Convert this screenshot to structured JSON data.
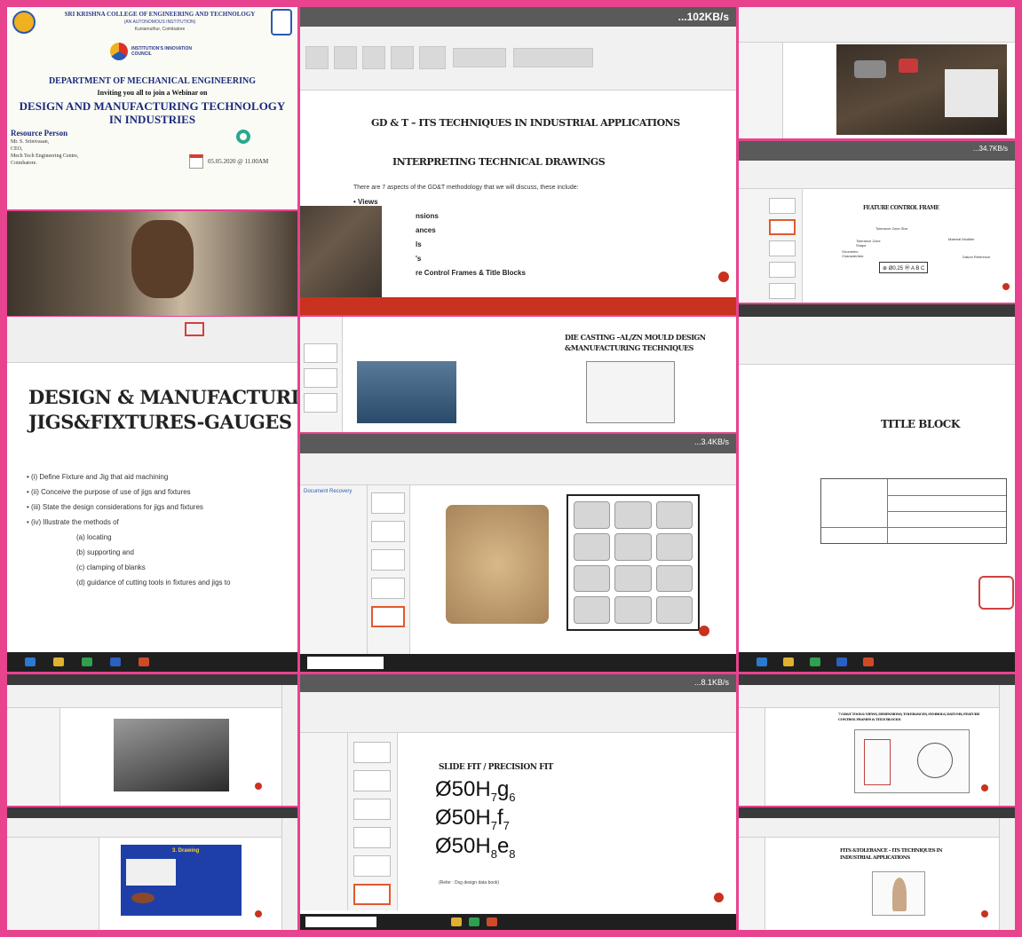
{
  "colors": {
    "frame": "#e8438f",
    "accent_orange": "#c8321e",
    "slide_blue": "#1f3fa8",
    "taskbar": "#1f1f1f"
  },
  "poster": {
    "college": "SRI KRISHNA COLLEGE OF ENGINEERING AND TECHNOLOGY",
    "autonomous": "(AN AUTONOMOUS INSTITUTION)",
    "location": "Kuniamuthur, Coimbatore",
    "council_badge": "INSTITUTION'S INNOVATION COUNCIL",
    "department": "DEPARTMENT OF MECHANICAL ENGINEERING",
    "invite": "Inviting you all to join a Webinar on",
    "title_line1": "DESIGN AND MANUFACTURING TECHNOLOGY",
    "title_line2": "IN INDUSTRIES",
    "resource_heading": "Resource Person",
    "person_name": "Mr. S. Srinivasan,",
    "person_role": "CEO,",
    "person_org": "Mech Tech Engineering Centre,",
    "person_city": "Coimbatore.",
    "date_time": "05.05.2020 @ 11.00AM"
  },
  "gdt_tile": {
    "network": "...102KB/s",
    "title": "GD & T – ITS TECHNIQUES IN INDUSTRIAL APPLICATIONS",
    "subtitle": "INTERPRETING TECHNICAL DRAWINGS",
    "intro": "There are 7 aspects of the GD&T methodology that we will discuss, these include:",
    "bullets": [
      "Views",
      "nsions",
      "ances",
      "ls",
      "'s",
      "re Control Frames & Title Blocks"
    ]
  },
  "fcf_tile": {
    "network": "...34.7KB/s",
    "title": "FEATURE CONTROL FRAME",
    "labels": [
      "Tolerance Zone Size",
      "Tolerance Zone Shape",
      "Geometric Characteristic",
      "Material Modifier",
      "Datum Reference"
    ],
    "frame_text": "⊕ Ø0.25 Ⓜ A B C"
  },
  "jigs_tile": {
    "title_line1": "DESIGN & MANUFACTURING TEC",
    "title_line2": "JIGS&FIXTURES-GAUGES",
    "items": [
      "(i) Define Fixture and Jig that aid machining",
      "(ii) Conceive the purpose of use of jigs and fixtures",
      "(iii) State the design considerations for jigs and fixtures",
      "(iv) Illustrate the methods of"
    ],
    "sub_items": [
      "(a) locating",
      "(b) supporting and",
      "(c) clamping of blanks",
      "(d) guidance of cutting tools in fixtures and jigs to"
    ]
  },
  "diecast_tile": {
    "title_line1": "DIE CASTING –AL/ZN MOULD DESIGN",
    "title_line2": "&MANUFACTURING TECHNIQUES"
  },
  "center_tile": {
    "network": "...3.4KB/s",
    "pane_title": "Document Recovery"
  },
  "title_block_tile": {
    "title": "TITLE BLOCK"
  },
  "fit_tile": {
    "network": "...8.1KB/s",
    "title": "SLIDE FIT / PRECISION FIT",
    "fits": [
      {
        "base": "Ø50H",
        "sub1": "7",
        "mid": "g",
        "sub2": "6"
      },
      {
        "base": "Ø50H",
        "sub1": "7",
        "mid": "f",
        "sub2": "7"
      },
      {
        "base": "Ø50H",
        "sub1": "8",
        "mid": "e",
        "sub2": "8"
      }
    ],
    "note": "(Refer : Dsg design data book)"
  },
  "br_tile1": {
    "title": "7 GD&T TOOLS: VIEWS, DIMENSIONS, TOLERANCES, SYMBOLS, DATUMS, FEATURE CONTROL FRAMES & TITLE BLOCKS"
  },
  "br_tile2": {
    "title_line1": "FITS &TOLERANCE – ITS TECHNIQUES IN",
    "title_line2": "INDUSTRIAL APPLICATIONS"
  },
  "bl_tile2": {
    "heading": "3. Drawing"
  }
}
